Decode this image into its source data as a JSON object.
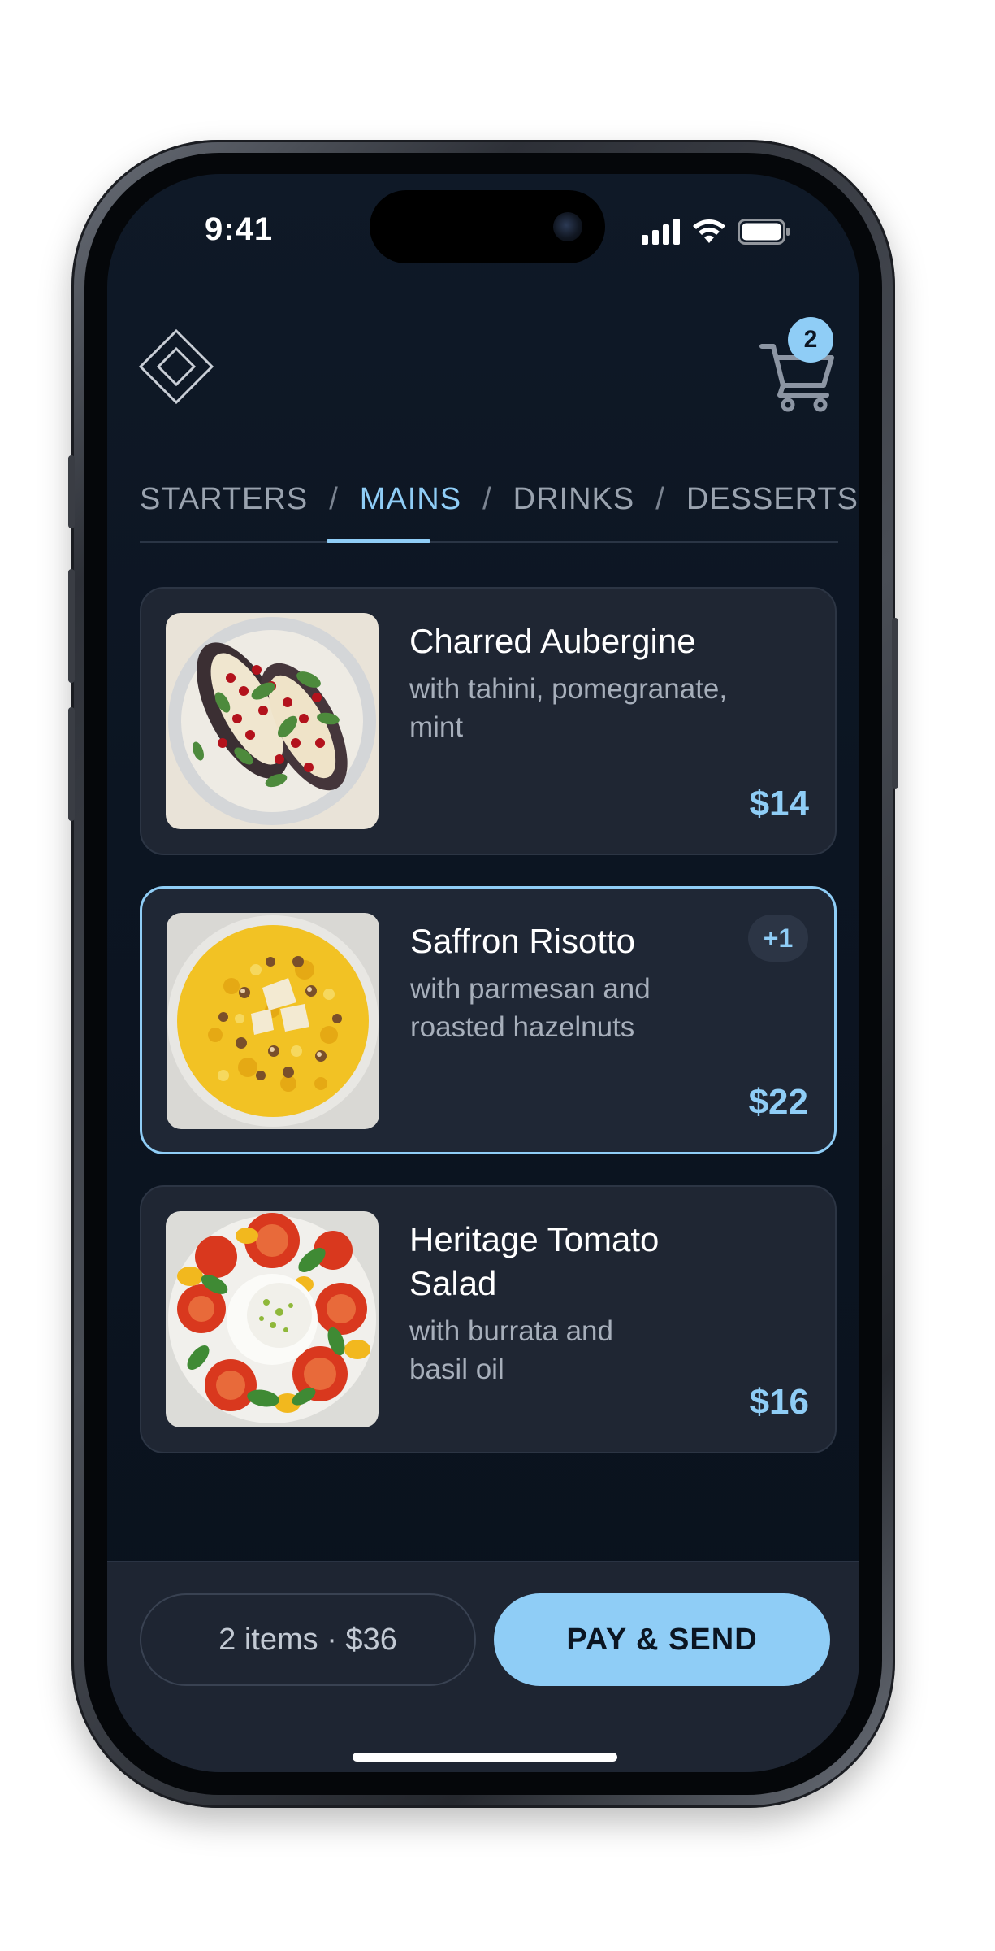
{
  "status_bar": {
    "time": "9:41",
    "signal_icon": "cellular-signal-icon",
    "wifi_icon": "wifi-icon",
    "battery_icon": "battery-icon"
  },
  "header": {
    "logo_icon": "diamond-logo-icon",
    "cart_icon": "shopping-cart-icon",
    "cart_count": "2"
  },
  "tabs": [
    {
      "label": "STARTERS",
      "active": false
    },
    {
      "label": "MAINS",
      "active": true
    },
    {
      "label": "DRINKS",
      "active": false
    },
    {
      "label": "DESSERTS",
      "active": false
    }
  ],
  "tab_separator": "/",
  "menu_items": [
    {
      "title": "Charred Aubergine",
      "description": "with tahini, pomegranate, mint",
      "price": "$14",
      "selected": false,
      "quantity_badge": ""
    },
    {
      "title": "Saffron Risotto",
      "description": "with parmesan and roasted hazelnuts",
      "price": "$22",
      "selected": true,
      "quantity_badge": "+1"
    },
    {
      "title": "Heritage Tomato Salad",
      "description": "with burrata and basil oil",
      "price": "$16",
      "selected": false,
      "quantity_badge": ""
    }
  ],
  "bottom_bar": {
    "summary": "2 items · $36",
    "pay_label": "PAY & SEND"
  },
  "colors": {
    "accent": "#8fcdf6",
    "background": "#0c1522",
    "card": "#1f2633",
    "text_primary": "#ffffff",
    "text_secondary": "#a7afbb"
  }
}
